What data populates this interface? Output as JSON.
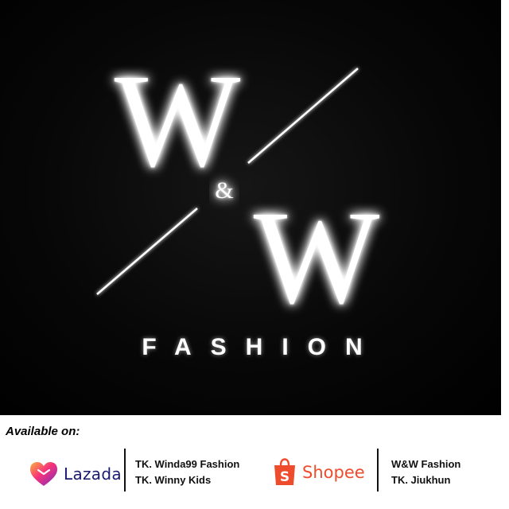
{
  "logo": {
    "letter_top": "W",
    "ampersand": "&",
    "letter_bottom": "W",
    "wordmark": "FASHION",
    "background_color": "#000000",
    "foreground_color": "#ffffff"
  },
  "footer": {
    "available_label": "Available on:",
    "stores": [
      {
        "platform": "Lazada",
        "icon": "lazada-heart-icon",
        "brand_color": "#f5337a",
        "shops": [
          "TK. Winda99 Fashion",
          "TK. Winny Kids"
        ]
      },
      {
        "platform": "Shopee",
        "icon": "shopee-bag-icon",
        "brand_color": "#ee4d2d",
        "shops": [
          "W&W Fashion",
          "TK. Jiukhun"
        ]
      }
    ]
  }
}
